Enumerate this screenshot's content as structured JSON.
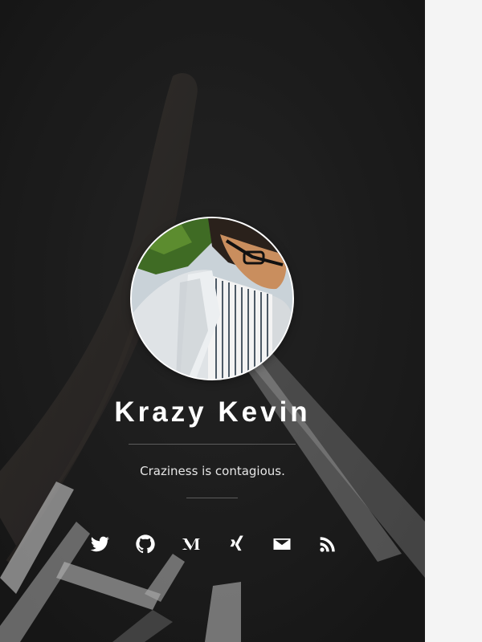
{
  "profile": {
    "name": "Krazy Kevin",
    "tagline": "Craziness is contagious."
  },
  "social_links": [
    {
      "icon": "twitter-icon"
    },
    {
      "icon": "github-icon"
    },
    {
      "icon": "medium-icon"
    },
    {
      "icon": "xing-icon"
    },
    {
      "icon": "mail-icon"
    },
    {
      "icon": "rss-icon"
    }
  ],
  "colors": {
    "hero_background": "#232323",
    "sidebar_background": "#f4f4f4",
    "text": "#ffffff"
  }
}
